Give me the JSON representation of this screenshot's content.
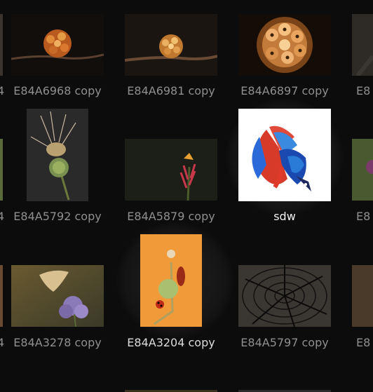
{
  "explorer": {
    "accent_selected": "#ffffff",
    "row1": {
      "partial_left_label": "4",
      "items": [
        {
          "label": "E84A6968 copy",
          "icon": "flower-on-branch-thumbnail"
        },
        {
          "label": "E84A6981 copy",
          "icon": "flower-on-branch-thumbnail"
        },
        {
          "label": "E84A6897 copy",
          "icon": "flower-closeup-thumbnail"
        }
      ],
      "partial_right_label": "E8"
    },
    "row2": {
      "partial_left_label": "4",
      "items": [
        {
          "label": "E84A5792 copy",
          "icon": "seedhead-plant-thumbnail"
        },
        {
          "label": "E84A5879 copy",
          "icon": "red-flower-thumbnail"
        },
        {
          "label": "sdw",
          "icon": "betta-fish-thumbnail",
          "selected": true
        }
      ],
      "partial_right_label": "E8"
    },
    "row3": {
      "partial_left_label": "4",
      "items": [
        {
          "label": "E84A3278 copy",
          "icon": "butterfly-thumbnail"
        },
        {
          "label": "E84A3204 copy",
          "icon": "ladybugs-thumbnail",
          "hovered": true
        },
        {
          "label": "E84A5797 copy",
          "icon": "wood-rings-thumbnail"
        }
      ],
      "partial_right_label": "E8"
    }
  }
}
